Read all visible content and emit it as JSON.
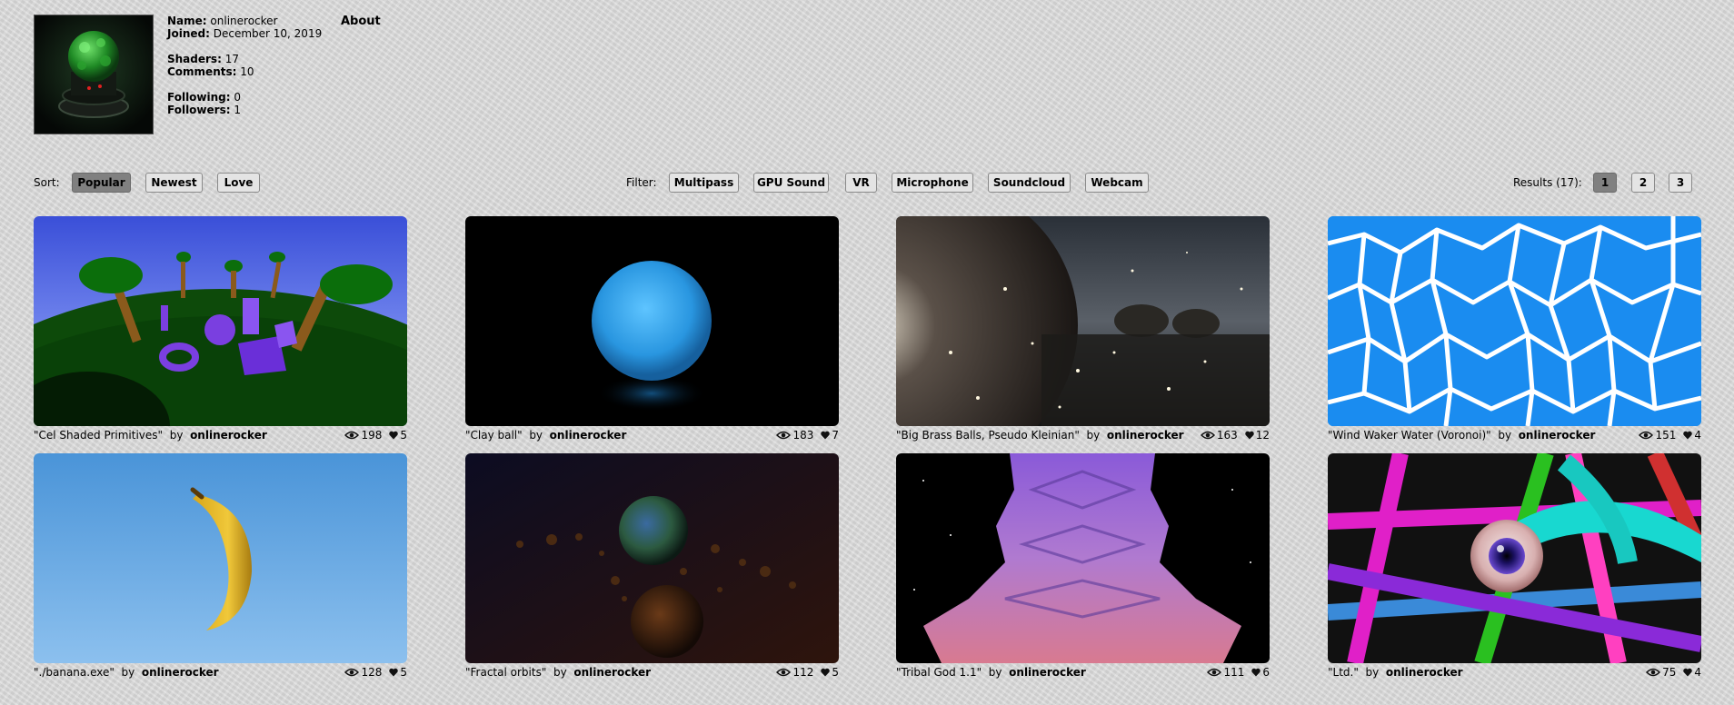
{
  "profile": {
    "name_label": "Name:",
    "name": "onlinerocker",
    "joined_label": "Joined:",
    "joined": "December 10, 2019",
    "shaders_label": "Shaders:",
    "shaders": "17",
    "comments_label": "Comments:",
    "comments": "10",
    "following_label": "Following:",
    "following": "0",
    "followers_label": "Followers:",
    "followers": "1",
    "about_label": "About"
  },
  "sort": {
    "label": "Sort:",
    "options": [
      "Popular",
      "Newest",
      "Love"
    ],
    "selected": "Popular"
  },
  "filter": {
    "label": "Filter:",
    "options": [
      "Multipass",
      "GPU Sound",
      "VR",
      "Microphone",
      "Soundcloud",
      "Webcam"
    ]
  },
  "results": {
    "label": "Results (17):",
    "pages": [
      "1",
      "2",
      "3"
    ],
    "current_page": "1"
  },
  "shaders": [
    {
      "title": "\"Cel Shaded Primitives\"",
      "by": "by",
      "author": "onlinerocker",
      "views": "198",
      "likes": "5"
    },
    {
      "title": "\"Clay ball\"",
      "by": "by",
      "author": "onlinerocker",
      "views": "183",
      "likes": "7"
    },
    {
      "title": "\"Big Brass Balls, Pseudo Kleinian\"",
      "by": "by",
      "author": "onlinerocker",
      "views": "163",
      "likes": "12"
    },
    {
      "title": "\"Wind Waker Water (Voronoi)\"",
      "by": "by",
      "author": "onlinerocker",
      "views": "151",
      "likes": "4"
    },
    {
      "title": "\"./banana.exe\"",
      "by": "by",
      "author": "onlinerocker",
      "views": "128",
      "likes": "5"
    },
    {
      "title": "\"Fractal orbits\"",
      "by": "by",
      "author": "onlinerocker",
      "views": "112",
      "likes": "5"
    },
    {
      "title": "\"Tribal God 1.1\"",
      "by": "by",
      "author": "onlinerocker",
      "views": "111",
      "likes": "6"
    },
    {
      "title": "\"Ltd.\"",
      "by": "by",
      "author": "onlinerocker",
      "views": "75",
      "likes": "4"
    }
  ],
  "icons": {
    "views": "eye-icon",
    "likes": "heart-icon"
  }
}
